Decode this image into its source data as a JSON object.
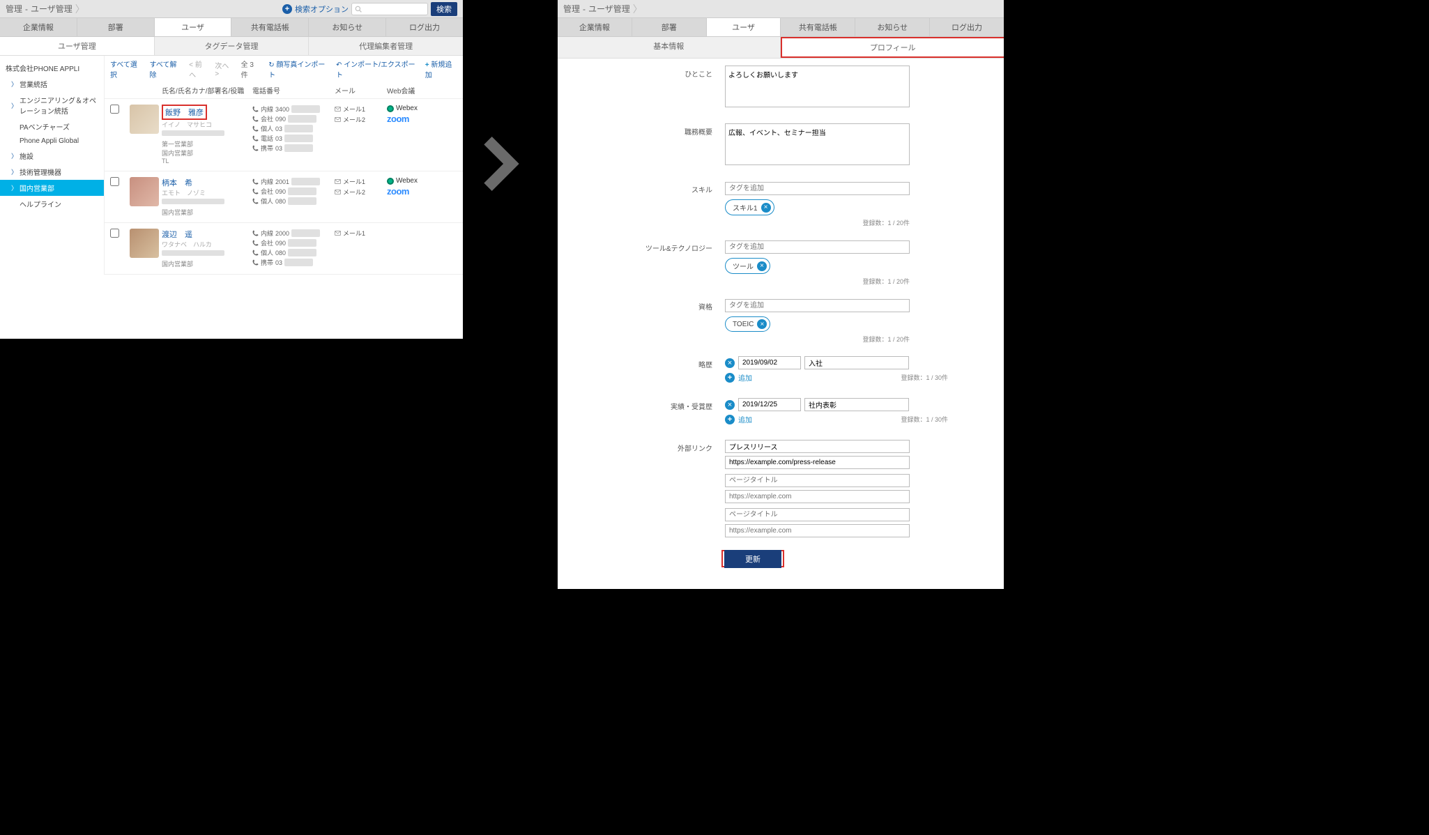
{
  "left": {
    "breadcrumb": [
      "管理",
      "ユーザ管理"
    ],
    "search_option": "検索オプション",
    "search_button": "検索",
    "tabs": [
      "企業情報",
      "部署",
      "ユーザ",
      "共有電話帳",
      "お知らせ",
      "ログ出力"
    ],
    "active_tab": 2,
    "subtabs": [
      "ユーザ管理",
      "タグデータ管理",
      "代理編集者管理"
    ],
    "active_subtab": 0,
    "sidebar": {
      "company": "株式会社PHONE APPLI",
      "items": [
        {
          "label": "営業統括",
          "exp": true
        },
        {
          "label": "エンジニアリング＆オペレーション統括",
          "exp": true
        },
        {
          "label": "PAベンチャーズ",
          "exp": false
        },
        {
          "label": "Phone Appli Global",
          "exp": false
        },
        {
          "label": "施設",
          "exp": true
        },
        {
          "label": "技術管理機器",
          "exp": true
        },
        {
          "label": "国内営業部",
          "exp": true,
          "selected": true
        },
        {
          "label": "ヘルプライン",
          "exp": false
        }
      ]
    },
    "toolbar": {
      "select_all": "すべて選択",
      "deselect_all": "すべて解除",
      "prev": "前へ",
      "next": "次へ",
      "count": "全 3 件",
      "photo_import": "顔写真インポート",
      "import_export": "インポート/エクスポート",
      "add_new": "新規追加"
    },
    "columns": {
      "name": "氏名/氏名カナ/部署名/役職",
      "phone": "電話番号",
      "mail": "メール",
      "conf": "Web会議"
    },
    "users": [
      {
        "name": "飯野　雅彦",
        "kana": "イイノ　マサヒコ",
        "dept1": "第一営業部",
        "dept2": "国内営業部",
        "role": "TL",
        "highlighted": true,
        "phones": [
          {
            "t": "内線",
            "n": "3400"
          },
          {
            "t": "会社",
            "n": "090"
          },
          {
            "t": "個人",
            "n": "03"
          },
          {
            "t": "電話",
            "n": "03"
          },
          {
            "t": "携帯",
            "n": "03"
          }
        ],
        "mails": [
          "メール1",
          "メール2"
        ],
        "webex": true,
        "zoom": true,
        "avatar": "m"
      },
      {
        "name": "柄本　希",
        "kana": "エモト　ノゾミ",
        "dept2": "国内営業部",
        "phones": [
          {
            "t": "内線",
            "n": "2001"
          },
          {
            "t": "会社",
            "n": "090"
          },
          {
            "t": "個人",
            "n": "080"
          }
        ],
        "mails": [
          "メール1",
          "メール2"
        ],
        "webex": true,
        "zoom": true,
        "avatar": "f1"
      },
      {
        "name": "渡辺　遥",
        "kana": "ワタナベ　ハルカ",
        "dept2": "国内営業部",
        "phones": [
          {
            "t": "内線",
            "n": "2000"
          },
          {
            "t": "会社",
            "n": "090"
          },
          {
            "t": "個人",
            "n": "080"
          },
          {
            "t": "携帯",
            "n": "03"
          }
        ],
        "mails": [
          "メール1"
        ],
        "webex": false,
        "zoom": false,
        "avatar": "f2"
      }
    ]
  },
  "right": {
    "breadcrumb": [
      "管理",
      "ユーザ管理"
    ],
    "tabs": [
      "企業情報",
      "部署",
      "ユーザ",
      "共有電話帳",
      "お知らせ",
      "ログ出力"
    ],
    "active_tab": 2,
    "subtabs": [
      "基本情報",
      "プロフィール"
    ],
    "active_subtab": 1,
    "form": {
      "hitokoto": {
        "label": "ひとこと",
        "value": "よろしくお願いします"
      },
      "summary": {
        "label": "職務概要",
        "value": "広報、イベント、セミナー担当"
      },
      "skill": {
        "label": "スキル",
        "placeholder": "タグを追加",
        "tags": [
          "スキル1"
        ],
        "count": "登録数：1 / 20件"
      },
      "tool": {
        "label": "ツール&テクノロジー",
        "placeholder": "タグを追加",
        "tags": [
          "ツール"
        ],
        "count": "登録数：1 / 20件"
      },
      "qual": {
        "label": "資格",
        "placeholder": "タグを追加",
        "tags": [
          "TOEIC"
        ],
        "count": "登録数：1 / 20件"
      },
      "history": {
        "label": "略歴",
        "date": "2019/09/02",
        "desc": "入社",
        "add": "追加",
        "count": "登録数：1 / 30件"
      },
      "award": {
        "label": "実績・受賞歴",
        "date": "2019/12/25",
        "desc": "社内表彰",
        "add": "追加",
        "count": "登録数：1 / 30件"
      },
      "link": {
        "label": "外部リンク",
        "title1": "プレスリリース",
        "url1": "https://example.com/press-release",
        "ph_title": "ページタイトル",
        "ph_url": "https://example.com"
      },
      "update": "更新"
    }
  }
}
